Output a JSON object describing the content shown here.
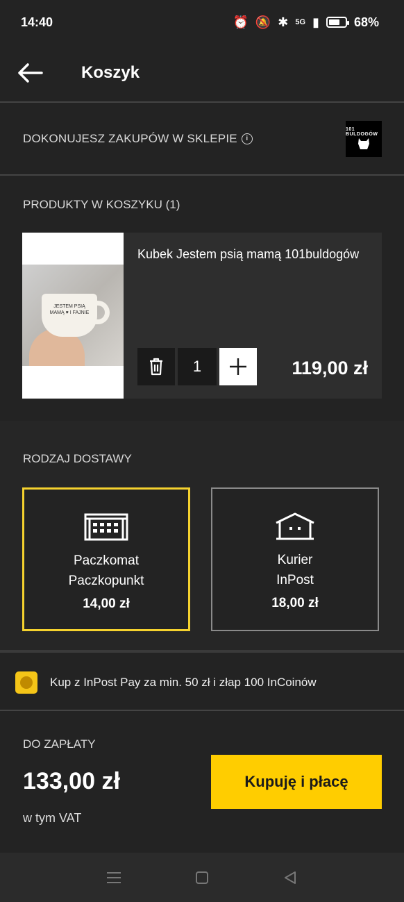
{
  "status_bar": {
    "time": "14:40",
    "network": "5G",
    "battery_percent": "68%",
    "battery_level": 0.68
  },
  "header": {
    "title": "Koszyk"
  },
  "shop": {
    "label": "DOKONUJESZ ZAKUPÓW W SKLEPIE",
    "logo_text": "101 BULDOGÓW"
  },
  "products": {
    "title": "PRODUKTY W KOSZYKU (1)",
    "items": [
      {
        "name": "Kubek Jestem psią mamą 101buldogów",
        "quantity": "1",
        "price": "119,00 zł",
        "mug_text": "JESTEM PSIĄ MAMĄ ♥ I FAJNIE"
      }
    ]
  },
  "delivery": {
    "title": "RODZAJ DOSTAWY",
    "options": [
      {
        "line1": "Paczkomat",
        "line2": "Paczkopunkt",
        "price": "14,00 zł",
        "selected": true,
        "icon": "parcel-locker-icon"
      },
      {
        "line1": "Kurier",
        "line2": "InPost",
        "price": "18,00 zł",
        "selected": false,
        "icon": "house-icon"
      }
    ],
    "selected_color": "#f5d22e"
  },
  "promo": {
    "text": "Kup z InPost Pay za min. 50 zł i złap 100 InCoinów"
  },
  "summary": {
    "label": "DO ZAPŁATY",
    "total": "133,00 zł",
    "vat_note": "w tym VAT",
    "buy_label": "Kupuję i płacę",
    "accent": "#ffcd00"
  }
}
